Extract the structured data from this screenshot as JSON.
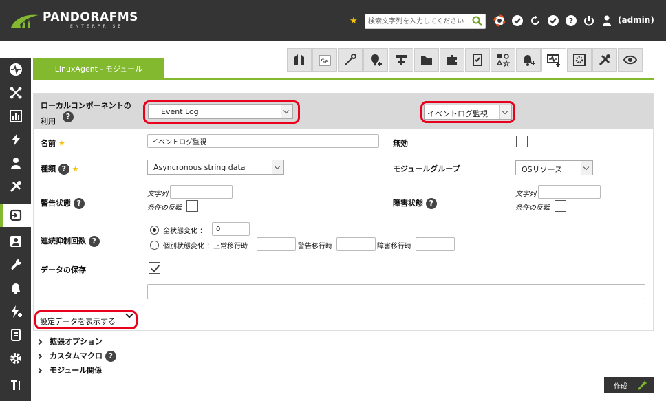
{
  "app": {
    "brand": "PANDORAFMS",
    "brand_sub": "ENTERPRISE",
    "user": "(admin)"
  },
  "search": {
    "placeholder": "検索文字列を入力してください"
  },
  "colors": {
    "accent": "#82b92e",
    "dark": "#343434",
    "highlight": "#e8001c",
    "star": "#f4c20d"
  },
  "tab": {
    "label": "LinuxAgent - モジュール"
  },
  "toolbar": {
    "icons": [
      "agent-icon",
      "module-editor-icon",
      "wand-icon",
      "add-alert-icon",
      "network-icon",
      "folder-icon",
      "plugin-icon",
      "checklist-icon",
      "shapes-icon",
      "add-notification-icon",
      "add-module-icon",
      "gear-box-icon",
      "tools-icon",
      "eye-icon"
    ]
  },
  "form": {
    "local_component_label_1": "ローカルコンポーネントの",
    "local_component_label_2": "利用",
    "local_component_value": "Event Log",
    "event_log_select": "イベントログ監視",
    "name_label": "名前",
    "name_value": "イベントログ監視",
    "disabled_label": "無効",
    "type_label": "種類",
    "type_value": "Asyncronous string data",
    "module_group_label": "モジュールグループ",
    "module_group_value": "OSリソース",
    "warning_label": "警告状態",
    "critical_label": "障害状態",
    "string_label": "文字列",
    "invert_label": "条件の反転",
    "ff_threshold_label": "連続抑制回数",
    "ff_all_label": "全状態変化 ：",
    "ff_all_value": "0",
    "ff_each_label": "個別状態変化 ：正常移行時",
    "ff_warning_label": "警告移行時",
    "ff_critical_label": "障害移行時",
    "historical_label": "データの保存",
    "show_config_label": "設定データを表示する"
  },
  "sections": [
    "拡張オプション",
    "カスタムマクロ",
    "モジュール関係"
  ],
  "create_button": "作成"
}
